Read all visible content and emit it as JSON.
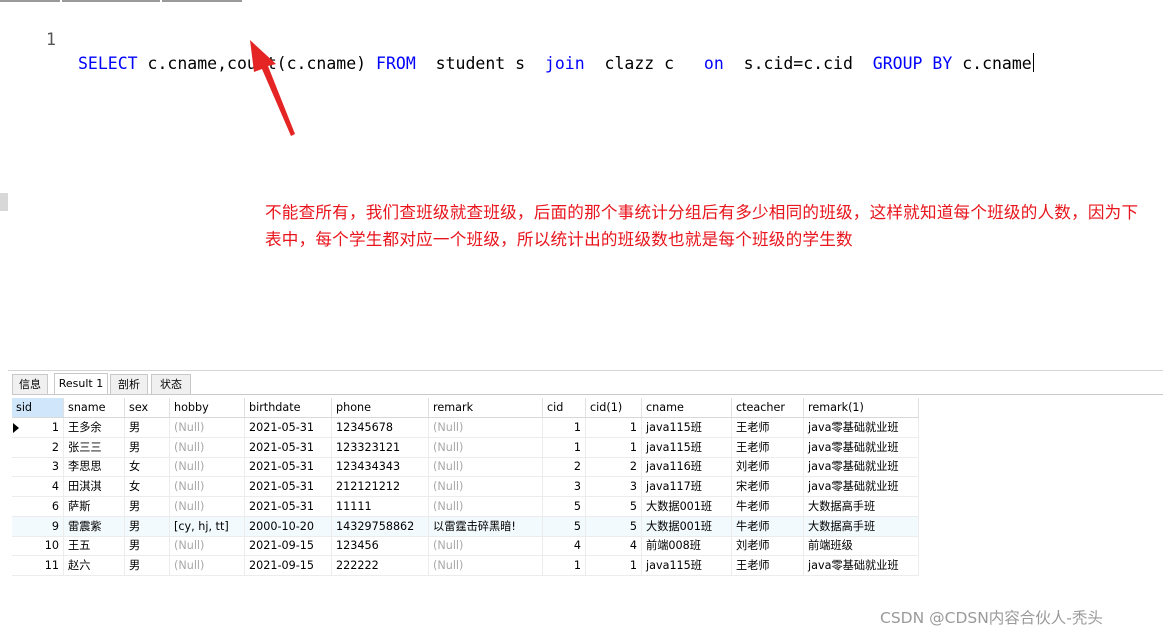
{
  "editor": {
    "line_number": "1",
    "tokens": [
      {
        "text": "SELECT",
        "kw": true
      },
      {
        "text": " c.cname,count(c.cname) ",
        "kw": false
      },
      {
        "text": "FROM",
        "kw": true
      },
      {
        "text": "  student s  ",
        "kw": false
      },
      {
        "text": "join",
        "kw": true
      },
      {
        "text": "  clazz c   ",
        "kw": false
      },
      {
        "text": "on",
        "kw": true
      },
      {
        "text": "  s.cid=c.cid  ",
        "kw": false
      },
      {
        "text": "GROUP BY",
        "kw": true
      },
      {
        "text": " c.cname",
        "kw": false
      }
    ]
  },
  "annotation": {
    "text": "不能查所有，我们查班级就查班级，后面的那个事统计分组后有多少相同的班级，这样就知道每个班级的人数，因为下表中，每个学生都对应一个班级，所以统计出的班级数也就是每个班级的学生数",
    "color": "#e8151c"
  },
  "tabs": [
    "信息",
    "Result 1",
    "剖析",
    "状态"
  ],
  "active_tab": "Result 1",
  "table": {
    "columns": [
      "sid",
      "sname",
      "sex",
      "hobby",
      "birthdate",
      "phone",
      "remark",
      "cid",
      "cid(1)",
      "cname",
      "cteacher",
      "remark(1)"
    ],
    "numeric_columns": [
      "sid",
      "cid",
      "cid(1)"
    ],
    "selected_column": "sid",
    "selected_row": 0,
    "null_text": "(Null)",
    "rows": [
      [
        "1",
        "王多余",
        "男",
        "(Null)",
        "2021-05-31",
        "12345678",
        "(Null)",
        "1",
        "1",
        "java115班",
        "王老师",
        "java零基础就业班"
      ],
      [
        "2",
        "张三三",
        "男",
        "(Null)",
        "2021-05-31",
        "123323121",
        "(Null)",
        "1",
        "1",
        "java115班",
        "王老师",
        "java零基础就业班"
      ],
      [
        "3",
        "李思思",
        "女",
        "(Null)",
        "2021-05-31",
        "123434343",
        "(Null)",
        "2",
        "2",
        "java116班",
        "刘老师",
        "java零基础就业班"
      ],
      [
        "4",
        "田淇淇",
        "女",
        "(Null)",
        "2021-05-31",
        "212121212",
        "(Null)",
        "3",
        "3",
        "java117班",
        "宋老师",
        "java零基础就业班"
      ],
      [
        "6",
        "萨斯",
        "男",
        "(Null)",
        "2021-05-31",
        "11111",
        "(Null)",
        "5",
        "5",
        "大数据001班",
        "牛老师",
        "大数据高手班"
      ],
      [
        "9",
        "雷震紫",
        "男",
        "[cy, hj, tt]",
        "2000-10-20",
        "14329758862",
        "以雷霆击碎黑暗!",
        "5",
        "5",
        "大数据001班",
        "牛老师",
        "大数据高手班"
      ],
      [
        "10",
        "王五",
        "男",
        "(Null)",
        "2021-09-15",
        "123456",
        "(Null)",
        "4",
        "4",
        "前端008班",
        "刘老师",
        "前端班级"
      ],
      [
        "11",
        "赵六",
        "男",
        "(Null)",
        "2021-09-15",
        "222222",
        "(Null)",
        "1",
        "1",
        "java115班",
        "王老师",
        "java零基础就业班"
      ]
    ]
  },
  "watermark": "CSDN @CDSN内容合伙人-秃头"
}
